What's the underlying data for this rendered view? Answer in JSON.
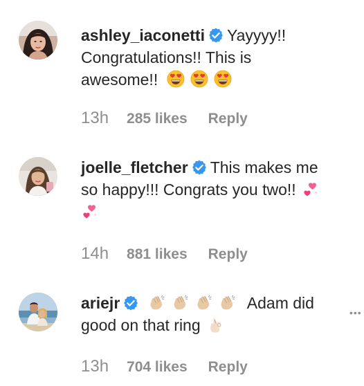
{
  "comments": [
    {
      "username": "ashley_iaconetti",
      "verified": true,
      "text_line1": "Yayyyy!!",
      "text_line2": "Congratulations!! This is",
      "text_line3": "awesome!!",
      "emojis": [
        "heart-eyes-emoji",
        "heart-eyes-emoji",
        "heart-eyes-emoji"
      ],
      "time": "13h",
      "likes": "285 likes",
      "reply": "Reply"
    },
    {
      "username": "joelle_fletcher",
      "verified": true,
      "text_line1": "This makes me",
      "text_line2": "so happy!!! Congrats you two!!",
      "emojis": [
        "two-hearts-emoji",
        "two-hearts-emoji"
      ],
      "time": "14h",
      "likes": "881 likes",
      "reply": "Reply"
    },
    {
      "username": "ariejr",
      "verified": true,
      "emojis_before": [
        "clapping-hands-emoji",
        "clapping-hands-emoji",
        "clapping-hands-emoji",
        "clapping-hands-emoji"
      ],
      "text_line1": "Adam did",
      "text_line2": "good on that ring",
      "emojis_after": [
        "ok-hand-emoji"
      ],
      "time": "13h",
      "likes": "704 likes",
      "reply": "Reply",
      "more_icon": "more-options-icon"
    }
  ],
  "colors": {
    "verified_badge": "#3897f0",
    "meta_text": "#8e8e8e",
    "primary_text": "#262626"
  }
}
